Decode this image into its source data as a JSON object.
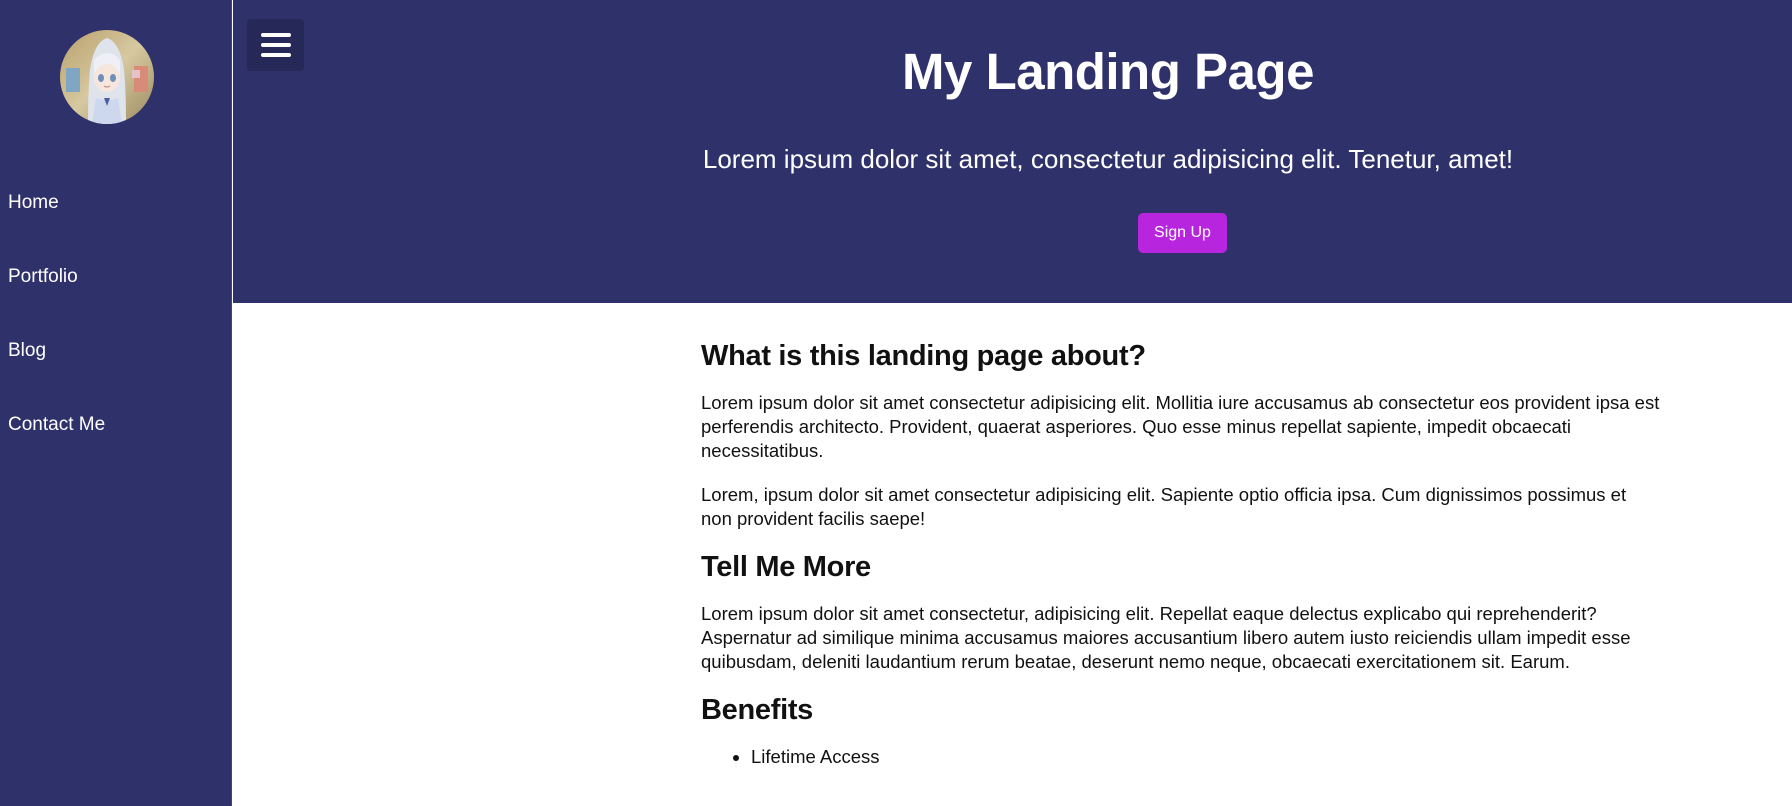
{
  "sidebar": {
    "avatar_alt": "avatar",
    "items": [
      {
        "label": "Home"
      },
      {
        "label": "Portfolio"
      },
      {
        "label": "Blog"
      },
      {
        "label": "Contact Me"
      }
    ]
  },
  "hero": {
    "menu_icon": "hamburger-menu-icon",
    "title": "My Landing Page",
    "subtitle": "Lorem ipsum dolor sit amet, consectetur adipisicing elit. Tenetur, amet!",
    "signup_label": "Sign Up"
  },
  "content": {
    "section1": {
      "heading": "What is this landing page about?",
      "paragraphs": [
        "Lorem ipsum dolor sit amet consectetur adipisicing elit. Mollitia iure accusamus ab consectetur eos provident ipsa est perferendis architecto. Provident, quaerat asperiores. Quo esse minus repellat sapiente, impedit obcaecati necessitatibus.",
        "Lorem, ipsum dolor sit amet consectetur adipisicing elit. Sapiente optio officia ipsa. Cum dignissimos possimus et non provident facilis saepe!"
      ]
    },
    "section2": {
      "heading": "Tell Me More",
      "paragraphs": [
        "Lorem ipsum dolor sit amet consectetur, adipisicing elit. Repellat eaque delectus explicabo qui reprehenderit? Aspernatur ad similique minima accusamus maiores accusantium libero autem iusto reiciendis ullam impedit esse quibusdam, deleniti laudantium rerum beatae, deserunt nemo neque, obcaecati exercitationem sit. Earum."
      ]
    },
    "section3": {
      "heading": "Benefits",
      "items": [
        "Lifetime Access"
      ]
    }
  },
  "colors": {
    "nav_bg": "#2f316b",
    "menu_toggle_bg": "#262857",
    "signup_bg": "#b726de",
    "text": "#111111"
  }
}
